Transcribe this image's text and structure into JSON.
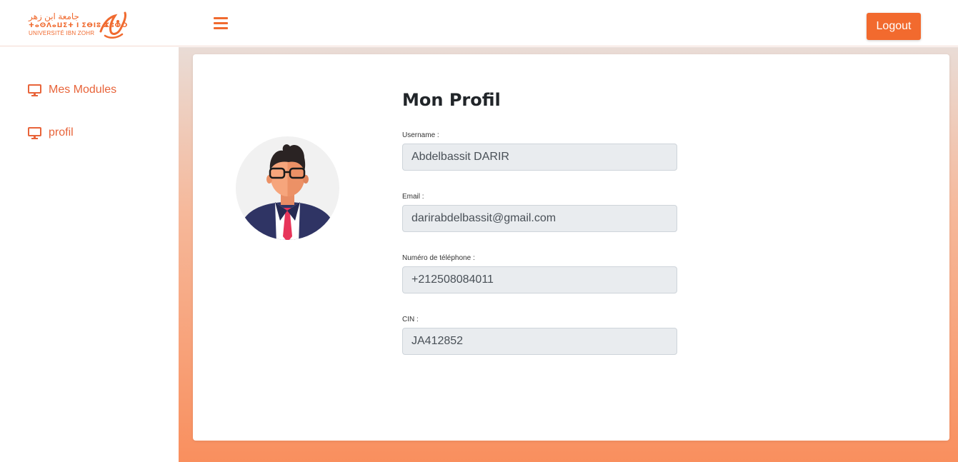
{
  "header": {
    "logo_arabic": "جامعة ابن زهر",
    "logo_tifinagh": "ⵜⴰⵙⴷⴰⵡⵉⵜ ⵏ ⵉⴱⵏⵓ ⵣⵓⵀⵔ",
    "logo_french": "UNIVERSITÉ IBN ZOHR",
    "logout_label": "Logout"
  },
  "sidebar": {
    "items": [
      {
        "label": "Mes Modules",
        "icon": "monitor-icon"
      },
      {
        "label": "profil",
        "icon": "monitor-icon"
      }
    ]
  },
  "profile": {
    "title": "Mon Profil",
    "fields": [
      {
        "label": "Username :",
        "value": "Abdelbassit DARIR"
      },
      {
        "label": "Email :",
        "value": "darirabdelbassit@gmail.com"
      },
      {
        "label": "Numéro de téléphone :",
        "value": "+212508084011"
      },
      {
        "label": "CIN :",
        "value": "JA412852"
      }
    ]
  },
  "colors": {
    "accent": "#f26a2e",
    "sidebar_text": "#e8643a",
    "input_bg": "#e9ecef"
  }
}
